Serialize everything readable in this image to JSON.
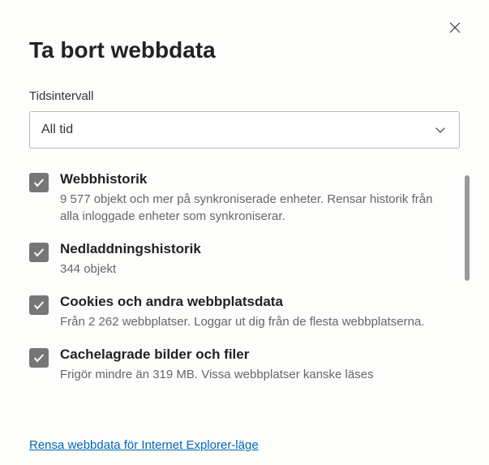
{
  "dialog": {
    "title": "Ta bort webbdata"
  },
  "timerange": {
    "label": "Tidsintervall",
    "selected": "All tid"
  },
  "items": [
    {
      "title": "Webbhistorik",
      "description": "9 577 objekt och mer på synkroniserade enheter. Rensar historik från alla inloggade enheter som synkroniserar."
    },
    {
      "title": "Nedladdningshistorik",
      "description": "344 objekt"
    },
    {
      "title": "Cookies och andra webbplatsdata",
      "description": "Från 2 262 webbplatser. Loggar ut dig från de flesta webbplatserna."
    },
    {
      "title": "Cachelagrade bilder och filer",
      "description": "Frigör mindre än 319 MB. Vissa webbplatser kanske läses"
    }
  ],
  "footer": {
    "link": "Rensa webbdata för Internet Explorer-läge"
  }
}
